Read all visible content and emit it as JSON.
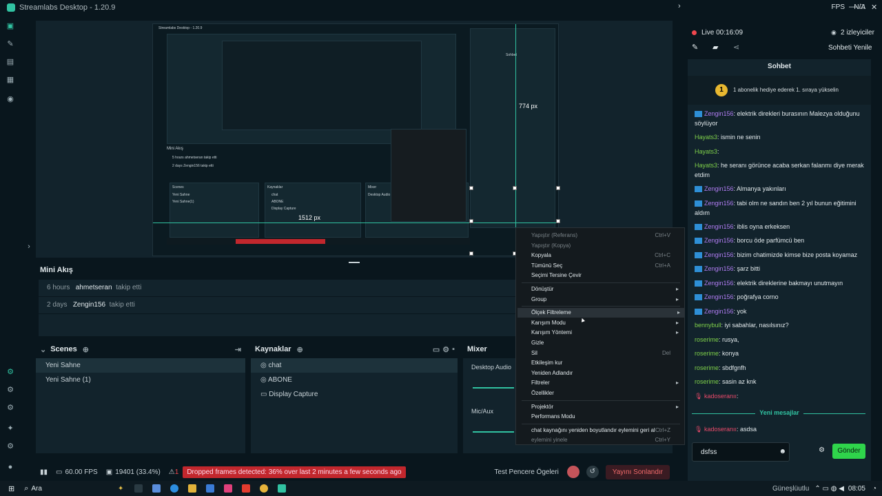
{
  "window": {
    "title": "Streamlabs Desktop - 1.20.9",
    "fps_label": "FPS",
    "fps_value": "N/A"
  },
  "inner_preview": {
    "title": "Streamlabs Desktop - 1.20.9",
    "measure_h": "1512 px",
    "measure_v": "774 px",
    "mini_rows": [
      {
        "time": "5 hours",
        "user": "ahmetseran",
        "action": "takip etti"
      },
      {
        "time": "2 days",
        "user": "Zengin156",
        "action": "takip etti"
      }
    ],
    "scenes_label": "Scenes",
    "sources_label": "Kaynaklar",
    "mixer_label": "Mixer",
    "scene_items": [
      "Yeni Sahne",
      "Yeni Sahne(1)"
    ],
    "source_items": [
      "chat",
      "ABONE",
      "Display Capture"
    ],
    "mixer_item": "Desktop Audio",
    "chat_title": "Sohbet"
  },
  "mini_feed": {
    "title": "Mini Akış",
    "rows": [
      {
        "time": "6 hours",
        "user": "ahmetseran",
        "action": "takip etti"
      },
      {
        "time": "2 days",
        "user": "Zengin156",
        "action": "takip etti"
      }
    ]
  },
  "scenes": {
    "title": "Scenes",
    "items": [
      "Yeni Sahne",
      "Yeni Sahne (1)"
    ]
  },
  "sources": {
    "title": "Kaynaklar",
    "items": [
      "chat",
      "ABONE",
      "Display Capture"
    ]
  },
  "mixer": {
    "title": "Mixer",
    "channels": [
      "Desktop Audio",
      "Mic/Aux"
    ]
  },
  "footer": {
    "fps": "60.00 FPS",
    "frames": "19401 (33.4%)",
    "alert_count": "1",
    "error": "Dropped frames detected: 36% over last 2 minutes a few seconds ago",
    "test_label": "Test Pencere Ögeleri",
    "end_label": "Yayını Sonlandır"
  },
  "taskbar": {
    "search": "Ara",
    "weather": "Güneşlüutlu",
    "time": "08:05"
  },
  "right_panel": {
    "live": "Live 00:16:09",
    "viewers": "2 izleyiciler",
    "refresh": "Sohbeti Yenile",
    "chat_title": "Sohbet",
    "banner": "1 abonelik hediye ederek 1. sıraya yükselin",
    "banner_rank": "1",
    "new_messages": "Yeni mesajlar",
    "input_value": "dsfss",
    "send": "Gönder",
    "messages": [
      {
        "user": "Zengin156",
        "text": ": elektrik direkleri burasının Malezya olduğunu söylüyor",
        "color": "purple",
        "badge": true
      },
      {
        "user": "Hayats3",
        "text": ": ismin ne senin",
        "color": "green",
        "badge": false
      },
      {
        "user": "Hayats3",
        "text": ":",
        "color": "green",
        "badge": false
      },
      {
        "user": "Hayats3",
        "text": ": he seranı görünce acaba serkan falanmı diye merak etdim",
        "color": "green",
        "badge": false
      },
      {
        "user": "Zengin156",
        "text": ": Almanya yakınları",
        "color": "purple",
        "badge": true
      },
      {
        "user": "Zengin156",
        "text": ": tabi olm ne sandın ben 2 yıl bunun eğitimini aldım",
        "color": "purple",
        "badge": true
      },
      {
        "user": "Zengin156",
        "text": ": iblis oyna erkeksen",
        "color": "purple",
        "badge": true
      },
      {
        "user": "Zengin156",
        "text": ": borcu öde parfümcü ben",
        "color": "purple",
        "badge": true
      },
      {
        "user": "Zengin156",
        "text": ": bizim chatimizde kimse bize posta koyamaz",
        "color": "purple",
        "badge": true
      },
      {
        "user": "Zengin156",
        "text": ": şarz bitti",
        "color": "purple",
        "badge": true
      },
      {
        "user": "Zengin156",
        "text": ": elektrik direklerine bakmayı unutmayın",
        "color": "purple",
        "badge": true
      },
      {
        "user": "Zengin156",
        "text": ": poğrafya corno",
        "color": "purple",
        "badge": true
      },
      {
        "user": "Zengin156",
        "text": ": yok",
        "color": "purple",
        "badge": true
      },
      {
        "user": "bennybull",
        "text": ": iyi sabahlar, nasılsınız?",
        "color": "green",
        "badge": false
      },
      {
        "user": "roserime",
        "text": ": rusya,",
        "color": "green",
        "badge": false
      },
      {
        "user": "roserime",
        "text": ": konya",
        "color": "green",
        "badge": false
      },
      {
        "user": "roserime",
        "text": ": sbdfgnfh",
        "color": "green",
        "badge": false
      },
      {
        "user": "roserime",
        "text": ": sasin az knk",
        "color": "green",
        "badge": false
      },
      {
        "user": "kadoseranıı",
        "text": ":",
        "color": "red",
        "badge": false
      }
    ],
    "after_new": {
      "user": "kadoseranıı",
      "text": ": asdsa"
    }
  },
  "context_menu": {
    "items": [
      {
        "label": "Yapıştır (Referans)",
        "shortcut": "Ctrl+V",
        "disabled": true
      },
      {
        "label": "Yapıştır (Kopya)",
        "shortcut": "",
        "disabled": true
      },
      {
        "label": "Kopyala",
        "shortcut": "Ctrl+C",
        "disabled": false
      },
      {
        "label": "Tümünü Seç",
        "shortcut": "Ctrl+A",
        "disabled": false
      },
      {
        "label": "Seçimi Tersine Çevir",
        "shortcut": "",
        "disabled": false
      },
      {
        "label": "Dönüştür",
        "shortcut": "",
        "submenu": true
      },
      {
        "label": "Group",
        "shortcut": "",
        "submenu": true
      },
      {
        "label": "Ölçek Filtreleme",
        "shortcut": "",
        "submenu": true,
        "highlight": true
      },
      {
        "label": "Karışım Modu",
        "shortcut": "",
        "submenu": true
      },
      {
        "label": "Karışım Yöntemi",
        "shortcut": "",
        "submenu": true
      },
      {
        "label": "Gizle",
        "shortcut": ""
      },
      {
        "label": "Sil",
        "shortcut": "Del"
      },
      {
        "label": "Etkileşim kur",
        "shortcut": ""
      },
      {
        "label": "Yeniden Adlandır",
        "shortcut": ""
      },
      {
        "label": "Filtreler",
        "shortcut": "",
        "submenu": true
      },
      {
        "label": "Özellikler",
        "shortcut": ""
      },
      {
        "label": "Projektör",
        "shortcut": "",
        "submenu": true
      },
      {
        "label": "Performans Modu",
        "shortcut": ""
      },
      {
        "label": "chat kaynağını yeniden boyutlandır eylemini geri al",
        "shortcut": "Ctrl+Z"
      },
      {
        "label": "eylemini yinele",
        "shortcut": "Ctrl+Y",
        "disabled": true
      }
    ]
  },
  "colors": {
    "accent": "#31c3a2",
    "error": "#c2272d",
    "live": "#f0474e",
    "send": "#2fd44b"
  }
}
